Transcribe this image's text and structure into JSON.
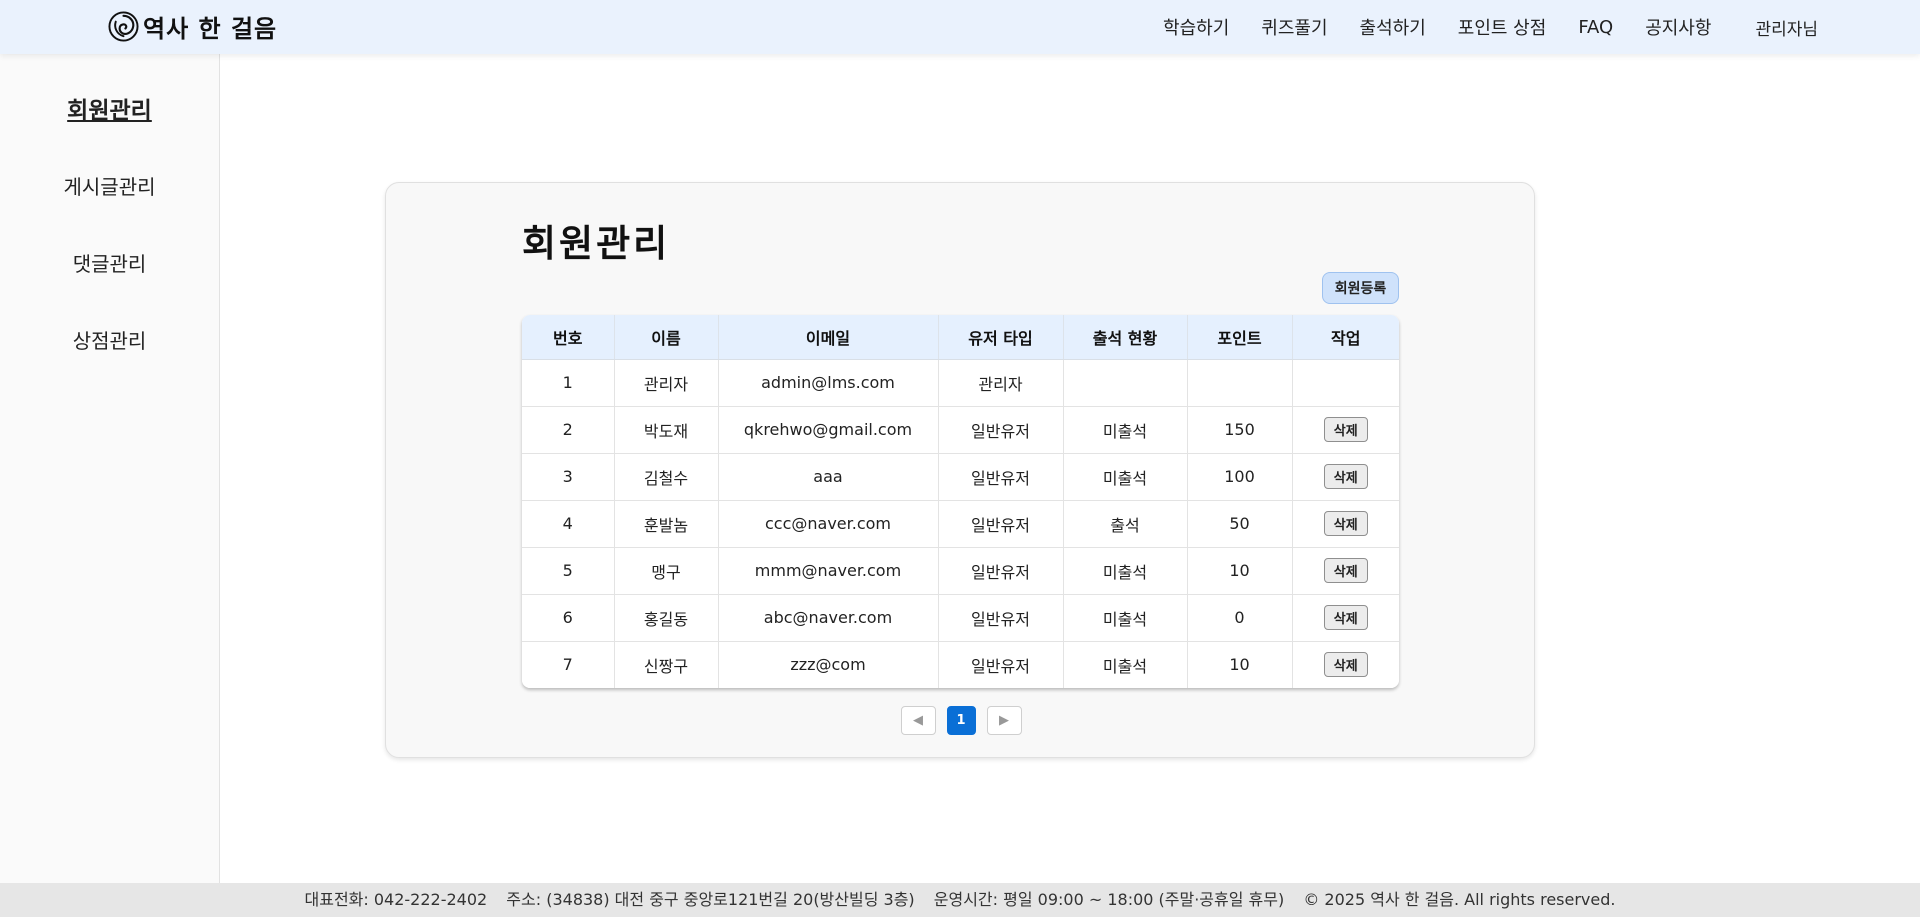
{
  "header": {
    "logo_text": "역사 한 걸음",
    "nav": [
      "학습하기",
      "퀴즈풀기",
      "출석하기",
      "포인트 상점",
      "FAQ",
      "공지사항"
    ],
    "user": "관리자님"
  },
  "sidebar": {
    "items": [
      {
        "label": "회원관리",
        "active": true
      },
      {
        "label": "게시글관리",
        "active": false
      },
      {
        "label": "댓글관리",
        "active": false
      },
      {
        "label": "상점관리",
        "active": false
      }
    ]
  },
  "main": {
    "title": "회원관리",
    "register_label": "회원등록",
    "columns": [
      "번호",
      "이름",
      "이메일",
      "유저 타입",
      "출석 현황",
      "포인트",
      "작업"
    ],
    "delete_label": "삭제",
    "rows": [
      {
        "no": "1",
        "name": "관리자",
        "email": "admin@lms.com",
        "type": "관리자",
        "attendance": "",
        "points": "",
        "deletable": false
      },
      {
        "no": "2",
        "name": "박도재",
        "email": "qkrehwo@gmail.com",
        "type": "일반유저",
        "attendance": "미출석",
        "points": "150",
        "deletable": true
      },
      {
        "no": "3",
        "name": "김철수",
        "email": "aaa",
        "type": "일반유저",
        "attendance": "미출석",
        "points": "100",
        "deletable": true
      },
      {
        "no": "4",
        "name": "훈발놈",
        "email": "ccc@naver.com",
        "type": "일반유저",
        "attendance": "출석",
        "points": "50",
        "deletable": true
      },
      {
        "no": "5",
        "name": "맹구",
        "email": "mmm@naver.com",
        "type": "일반유저",
        "attendance": "미출석",
        "points": "10",
        "deletable": true
      },
      {
        "no": "6",
        "name": "홍길동",
        "email": "abc@naver.com",
        "type": "일반유저",
        "attendance": "미출석",
        "points": "0",
        "deletable": true
      },
      {
        "no": "7",
        "name": "신짱구",
        "email": "zzz@com",
        "type": "일반유저",
        "attendance": "미출석",
        "points": "10",
        "deletable": true
      }
    ],
    "pagination": {
      "prev": "◀",
      "current": "1",
      "next": "▶"
    }
  },
  "footer": {
    "phone": "대표전화: 042-222-2402",
    "address": "주소: (34838) 대전 중구 중앙로121번길 20(방산빌딩 3층)",
    "hours": "운영시간: 평일 09:00 ~ 18:00 (주말·공휴일 휴무)",
    "copyright": "© 2025 역사 한 걸음. All rights reserved."
  },
  "colors": {
    "header_bg": "#eaf2fd",
    "table_header_bg": "#e5f0fe",
    "register_button_bg": "#cfe2fb",
    "pagination_active": "#0a6fd6",
    "footer_bg": "#e6e6e6"
  }
}
